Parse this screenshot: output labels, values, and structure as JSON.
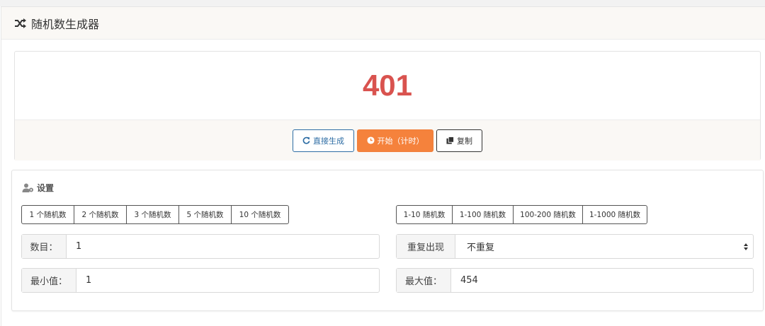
{
  "header": {
    "title": "随机数生成器",
    "icon": "shuffle-icon"
  },
  "result": {
    "value": "401",
    "color": "#d9534f"
  },
  "actions": {
    "generate_label": "直接生成",
    "start_label": "开始（计时）",
    "copy_label": "复制"
  },
  "settings": {
    "title": "设置",
    "count_presets": [
      "1 个随机数",
      "2 个随机数",
      "3 个随机数",
      "5 个随机数",
      "10 个随机数"
    ],
    "range_presets": [
      "1-10 随机数",
      "1-100 随机数",
      "100-200 随机数",
      "1-1000 随机数"
    ],
    "count": {
      "label": "数目：",
      "value": "1"
    },
    "repeat": {
      "label": "重复出现",
      "value": "不重复"
    },
    "min": {
      "label": "最小值：",
      "value": "1"
    },
    "max": {
      "label": "最大值：",
      "value": "454"
    }
  },
  "colors": {
    "accent_orange": "#f5823c",
    "primary_blue": "#2e6da4",
    "result_red": "#d9534f"
  }
}
